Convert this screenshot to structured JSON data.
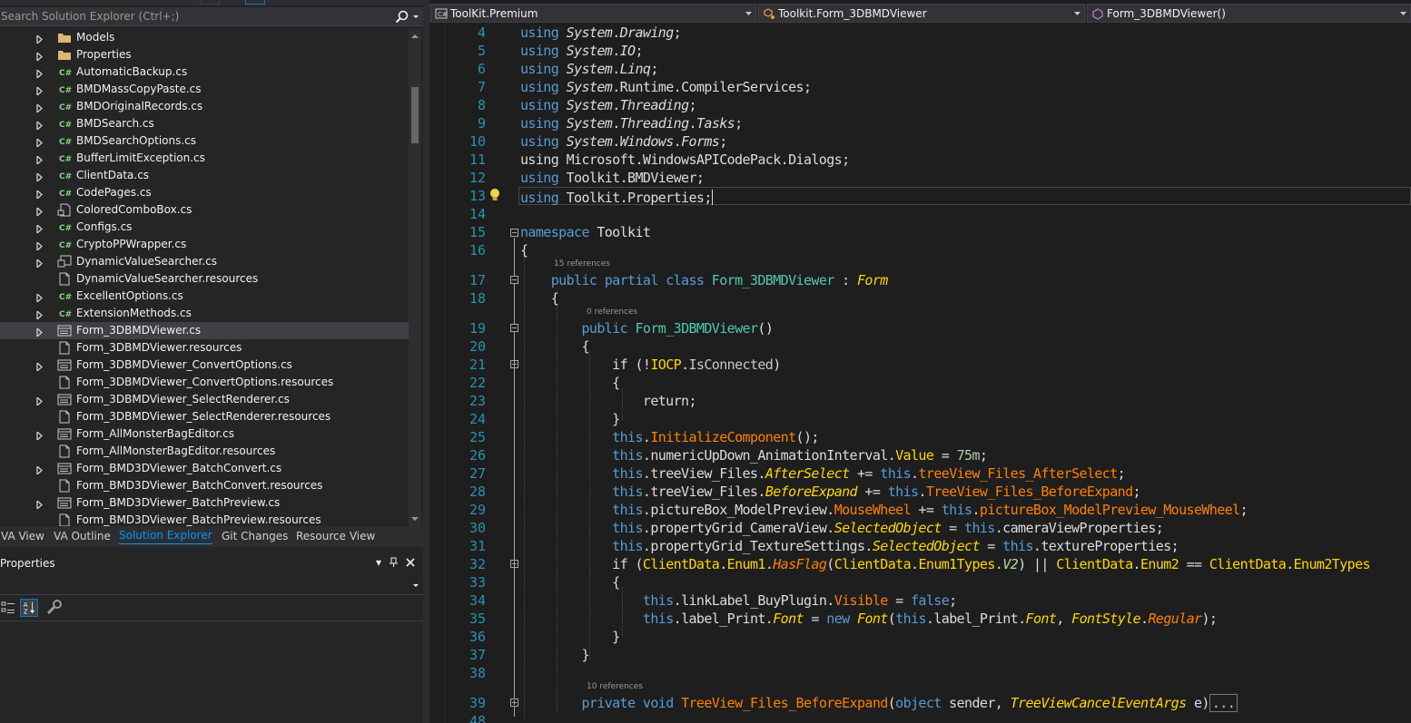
{
  "solution_explorer": {
    "search_placeholder": "Search Solution Explorer (Ctrl+;)",
    "items": [
      {
        "label": "Models",
        "icon": "folder-icon",
        "expandable": true
      },
      {
        "label": "Properties",
        "icon": "folder-icon",
        "expandable": true
      },
      {
        "label": "AutomaticBackup.cs",
        "icon": "csharp-file-icon",
        "expandable": true
      },
      {
        "label": "BMDMassCopyPaste.cs",
        "icon": "csharp-file-icon",
        "expandable": true
      },
      {
        "label": "BMDOriginalRecords.cs",
        "icon": "csharp-file-icon",
        "expandable": true
      },
      {
        "label": "BMDSearch.cs",
        "icon": "csharp-file-icon",
        "expandable": true
      },
      {
        "label": "BMDSearchOptions.cs",
        "icon": "csharp-file-icon",
        "expandable": true
      },
      {
        "label": "BufferLimitException.cs",
        "icon": "csharp-file-icon",
        "expandable": true
      },
      {
        "label": "ClientData.cs",
        "icon": "csharp-file-icon",
        "expandable": true
      },
      {
        "label": "CodePages.cs",
        "icon": "csharp-file-icon",
        "expandable": true
      },
      {
        "label": "ColoredComboBox.cs",
        "icon": "component-file-icon",
        "expandable": true
      },
      {
        "label": "Configs.cs",
        "icon": "csharp-file-icon",
        "expandable": true
      },
      {
        "label": "CryptoPPWrapper.cs",
        "icon": "csharp-file-icon",
        "expandable": true
      },
      {
        "label": "DynamicValueSearcher.cs",
        "icon": "form-file-icon",
        "expandable": true
      },
      {
        "label": "DynamicValueSearcher.resources",
        "icon": "resource-file-icon",
        "expandable": false
      },
      {
        "label": "ExcellentOptions.cs",
        "icon": "csharp-file-icon",
        "expandable": true
      },
      {
        "label": "ExtensionMethods.cs",
        "icon": "csharp-file-icon",
        "expandable": true
      },
      {
        "label": "Form_3DBMDViewer.cs",
        "icon": "windows-form-icon",
        "expandable": true,
        "selected": true
      },
      {
        "label": "Form_3DBMDViewer.resources",
        "icon": "resource-file-icon",
        "expandable": false
      },
      {
        "label": "Form_3DBMDViewer_ConvertOptions.cs",
        "icon": "windows-form-icon",
        "expandable": true
      },
      {
        "label": "Form_3DBMDViewer_ConvertOptions.resources",
        "icon": "resource-file-icon",
        "expandable": false
      },
      {
        "label": "Form_3DBMDViewer_SelectRenderer.cs",
        "icon": "windows-form-icon",
        "expandable": true
      },
      {
        "label": "Form_3DBMDViewer_SelectRenderer.resources",
        "icon": "resource-file-icon",
        "expandable": false
      },
      {
        "label": "Form_AllMonsterBagEditor.cs",
        "icon": "windows-form-icon",
        "expandable": true
      },
      {
        "label": "Form_AllMonsterBagEditor.resources",
        "icon": "resource-file-icon",
        "expandable": false
      },
      {
        "label": "Form_BMD3DViewer_BatchConvert.cs",
        "icon": "windows-form-icon",
        "expandable": true
      },
      {
        "label": "Form_BMD3DViewer_BatchConvert.resources",
        "icon": "resource-file-icon",
        "expandable": false
      },
      {
        "label": "Form_BMD3DViewer_BatchPreview.cs",
        "icon": "windows-form-icon",
        "expandable": true
      },
      {
        "label": "Form_BMD3DViewer_BatchPreview.resources",
        "icon": "resource-file-icon",
        "expandable": false
      }
    ]
  },
  "panel_tabs": [
    {
      "label": "VA View",
      "active": false
    },
    {
      "label": "VA Outline",
      "active": false
    },
    {
      "label": "Solution Explorer",
      "active": true
    },
    {
      "label": "Git Changes",
      "active": false
    },
    {
      "label": "Resource View",
      "active": false
    }
  ],
  "properties": {
    "title": "Properties",
    "pin_glyph": "▾",
    "autohide_glyph": "⊥",
    "close_glyph": "✕"
  },
  "editor": {
    "nav": {
      "project": "ToolKit.Premium",
      "type": "Toolkit.Form_3DBMDViewer",
      "member": "Form_3DBMDViewer()"
    },
    "lens": {
      "class_refs": "15 references",
      "ctor_refs": "0 references",
      "method_refs": "10 references"
    },
    "line_numbers": [
      "4",
      "5",
      "6",
      "7",
      "8",
      "9",
      "10",
      "11",
      "12",
      "13",
      "14",
      "15",
      "16",
      "17",
      "18",
      "19",
      "20",
      "21",
      "22",
      "23",
      "24",
      "25",
      "26",
      "27",
      "28",
      "29",
      "30",
      "31",
      "32",
      "33",
      "34",
      "35",
      "36",
      "37",
      "38",
      "39",
      "48"
    ]
  },
  "colors": {
    "accent": "#007acc",
    "active_tab": "#0097fb",
    "line_number": "#2b91af",
    "keyword": "#569cd6",
    "type": "#4ec9b0"
  }
}
